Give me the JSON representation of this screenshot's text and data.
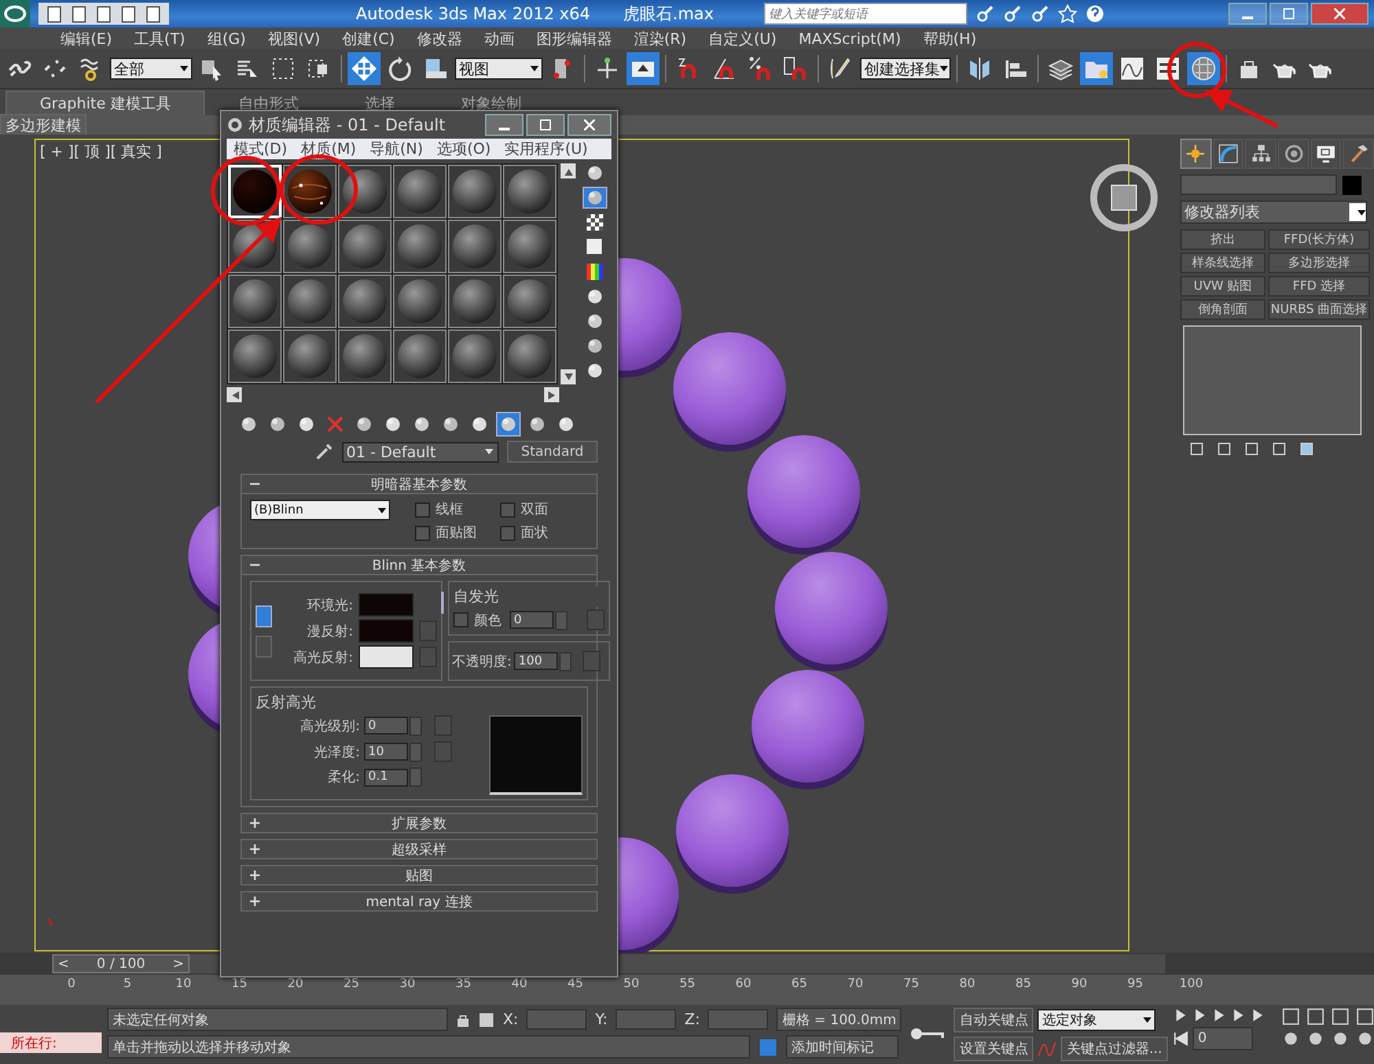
{
  "title_bar": {
    "title": "Autodesk 3ds Max  2012 x64",
    "file_name": "虎眼石.max",
    "search": {
      "placeholder": "键入关键字或短语"
    }
  },
  "menu_bar": [
    "编辑(E)",
    "工具(T)",
    "组(G)",
    "视图(V)",
    "创建(C)",
    "修改器",
    "动画",
    "图形编辑器",
    "渲染(R)",
    "自定义(U)",
    "MAXScript(M)",
    "帮助(H)"
  ],
  "main_toolbar": [
    {
      "kind": "link",
      "selected": false
    },
    {
      "kind": "unlink",
      "selected": false
    },
    {
      "kind": "bind",
      "selected": false
    },
    {
      "kind": "dropdown",
      "value": "全部"
    },
    {
      "kind": "select",
      "selected": false
    },
    {
      "kind": "selectname",
      "selected": false
    },
    {
      "kind": "rectangle",
      "selected": false
    },
    {
      "kind": "crossing",
      "selected": false
    },
    {
      "kind": "separator"
    },
    {
      "kind": "move",
      "selected": true
    },
    {
      "kind": "rotate",
      "selected": false
    },
    {
      "kind": "scale",
      "selected": false
    },
    {
      "kind": "dropdown",
      "value": "视图"
    },
    {
      "kind": "pivot",
      "selected": false
    },
    {
      "kind": "separator"
    },
    {
      "kind": "manipulate",
      "selected": false
    },
    {
      "kind": "keyboard",
      "selected": true
    },
    {
      "kind": "separator"
    },
    {
      "kind": "snap",
      "selected": false
    },
    {
      "kind": "anglesnap",
      "selected": false
    },
    {
      "kind": "percentsnap",
      "selected": false
    },
    {
      "kind": "spinnersnap",
      "selected": false
    },
    {
      "kind": "separator"
    },
    {
      "kind": "editset",
      "selected": false
    },
    {
      "kind": "dropdown",
      "value": "创建选择集"
    },
    {
      "kind": "separator"
    },
    {
      "kind": "mirror",
      "selected": false
    },
    {
      "kind": "align",
      "selected": false
    },
    {
      "kind": "separator"
    },
    {
      "kind": "layers",
      "selected": false
    },
    {
      "kind": "explorer",
      "selected": true
    },
    {
      "kind": "curve",
      "selected": false
    },
    {
      "kind": "schematic",
      "selected": false
    },
    {
      "kind": "material",
      "selected": true
    },
    {
      "kind": "separator"
    },
    {
      "kind": "rendersetup",
      "selected": false
    },
    {
      "kind": "teapot",
      "selected": false
    },
    {
      "kind": "teapot",
      "selected": false
    }
  ],
  "ribbon": {
    "tabs": [
      {
        "label": "Graphite 建模工具",
        "selected": true
      },
      {
        "label": "自由形式",
        "selected": false
      },
      {
        "label": "选择",
        "selected": false
      },
      {
        "label": "对象绘制",
        "selected": false
      }
    ],
    "panel": "多边形建模"
  },
  "viewport": {
    "label": "[ + ][ 顶 ][ 真实 ]",
    "active": true
  },
  "material_editor": {
    "title": "材质编辑器 - 01 - Default",
    "menu": [
      "模式(D)",
      "材质(M)",
      "导航(N)",
      "选项(O)",
      "实用程序(U)"
    ],
    "slots": [
      {
        "kind": "dark",
        "selected": true
      },
      {
        "kind": "amber",
        "selected": false
      },
      {
        "kind": "default",
        "selected": false
      },
      {
        "kind": "default",
        "selected": false
      },
      {
        "kind": "default",
        "selected": false
      },
      {
        "kind": "default",
        "selected": false
      },
      {
        "kind": "default",
        "selected": false
      },
      {
        "kind": "default",
        "selected": false
      },
      {
        "kind": "default",
        "selected": false
      },
      {
        "kind": "default",
        "selected": false
      },
      {
        "kind": "default",
        "selected": false
      },
      {
        "kind": "default",
        "selected": false
      },
      {
        "kind": "default",
        "selected": false
      },
      {
        "kind": "default",
        "selected": false
      },
      {
        "kind": "default",
        "selected": false
      },
      {
        "kind": "default",
        "selected": false
      },
      {
        "kind": "default",
        "selected": false
      },
      {
        "kind": "default",
        "selected": false
      },
      {
        "kind": "default",
        "selected": false
      },
      {
        "kind": "default",
        "selected": false
      },
      {
        "kind": "default",
        "selected": false
      },
      {
        "kind": "default",
        "selected": false
      },
      {
        "kind": "default",
        "selected": false
      },
      {
        "kind": "default",
        "selected": false
      }
    ],
    "side_tools": [
      {
        "selected": false
      },
      {
        "selected": true
      },
      {
        "selected": false
      },
      {
        "selected": false
      },
      {
        "selected": false
      },
      {
        "selected": false
      },
      {
        "selected": false
      },
      {
        "selected": false
      },
      {
        "selected": false
      }
    ],
    "bottom_tools": [
      {
        "selected": false
      },
      {
        "selected": false
      },
      {
        "selected": false
      },
      {
        "selected": false
      },
      {
        "selected": false
      },
      {
        "selected": false
      },
      {
        "selected": false
      },
      {
        "selected": false
      },
      {
        "selected": false
      },
      {
        "selected": true
      },
      {
        "selected": false
      },
      {
        "selected": false
      }
    ],
    "material_name": "01 - Default",
    "material_type": "Standard",
    "shader_rollout": {
      "title": "明暗器基本参数",
      "expanded": true,
      "shader": "(B)Blinn",
      "options": [
        {
          "label": "线框",
          "checked": false
        },
        {
          "label": "双面",
          "checked": false
        },
        {
          "label": "面贴图",
          "checked": false
        },
        {
          "label": "面状",
          "checked": false
        }
      ]
    },
    "blinn_rollout": {
      "title": "Blinn 基本参数",
      "expanded": true,
      "colors": [
        {
          "label": "环境光:",
          "color": "#0e0505"
        },
        {
          "label": "漫反射:",
          "color": "#100404"
        },
        {
          "label": "高光反射:",
          "color": "#e6e6e6"
        }
      ],
      "self_illum": {
        "title": "自发光",
        "label": "颜色",
        "checked": false,
        "value": "0"
      },
      "opacity": {
        "label": "不透明度:",
        "value": "100"
      },
      "specular": {
        "title": "反射高光",
        "fields": [
          {
            "label": "高光级别:",
            "value": "0"
          },
          {
            "label": "光泽度:",
            "value": "10"
          },
          {
            "label": "柔化:",
            "value": "0.1"
          }
        ]
      }
    },
    "collapsed_rollouts": [
      {
        "title": "扩展参数",
        "expanded": false
      },
      {
        "title": "超级采样",
        "expanded": false
      },
      {
        "title": "贴图",
        "expanded": false
      },
      {
        "title": "mental ray 连接",
        "expanded": false
      }
    ]
  },
  "command_panel": {
    "tabs": [
      {
        "kind": "create",
        "selected": true
      },
      {
        "kind": "modify",
        "selected": false
      },
      {
        "kind": "hierarchy",
        "selected": false
      },
      {
        "kind": "motion",
        "selected": false
      },
      {
        "kind": "display",
        "selected": false
      },
      {
        "kind": "utilities",
        "selected": false
      }
    ],
    "modifier_list": "修改器列表",
    "modifier_buttons": [
      "挤出",
      "FFD(长方体)",
      "样条线选择",
      "多边形选择",
      "UVW 贴图",
      "FFD 选择",
      "倒角剖面",
      "NURBS 曲面选择"
    ]
  },
  "time_slider": {
    "frame": "0 / 100",
    "prev": "<",
    "next": ">",
    "level": 0
  },
  "track_bar": {
    "ticks": [
      "0",
      "5",
      "10",
      "15",
      "20",
      "25",
      "30",
      "35",
      "40",
      "45",
      "50",
      "55",
      "60",
      "65",
      "70",
      "75",
      "80",
      "85",
      "90",
      "95",
      "100"
    ]
  },
  "status_bar": {
    "listener": "所在行:",
    "selection": "未选定任何对象",
    "prompt": "单击并拖动以选择并移动对象",
    "coords": [
      "X:",
      "Y:",
      "Z:"
    ],
    "grid": "栅格 = 100.0mm",
    "time_tag": "添加时间标记",
    "auto_key": "自动关键点",
    "set_key": "设置关键点",
    "key_mode": "选定对象",
    "key_filters": "关键点过滤器...",
    "frame": "0"
  }
}
